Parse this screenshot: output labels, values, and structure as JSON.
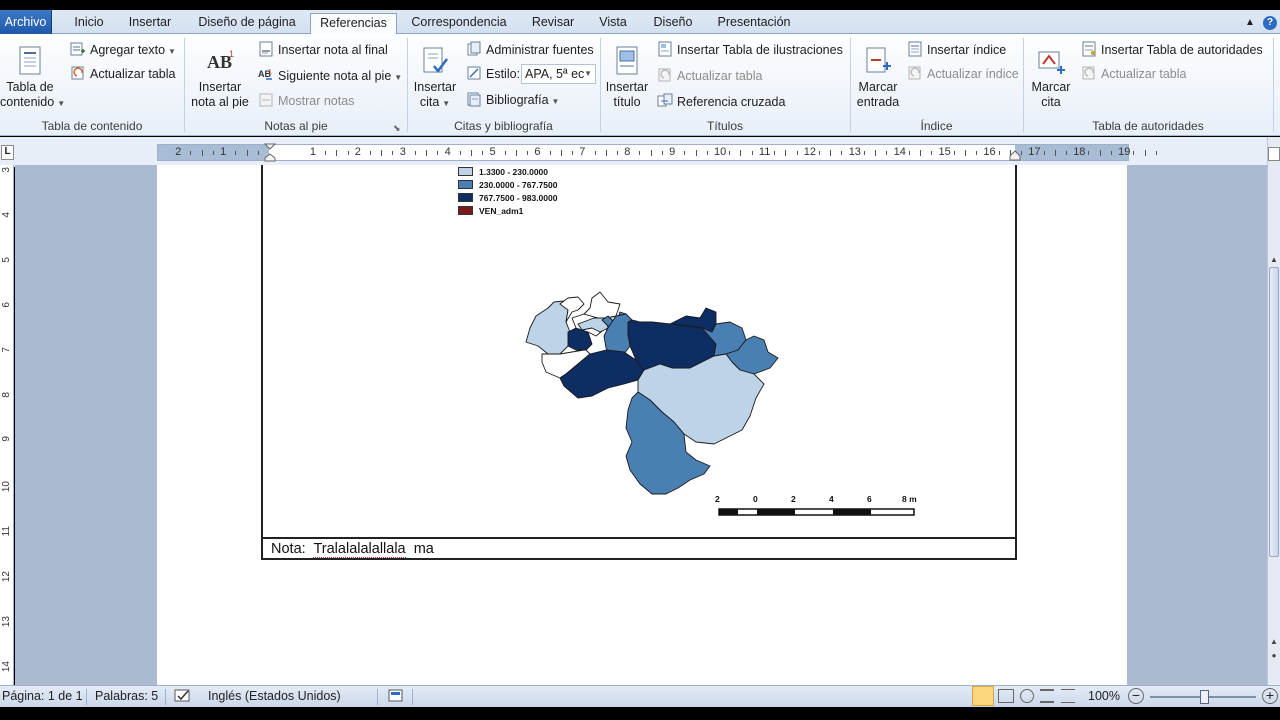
{
  "tabs": [
    {
      "label": "Archivo"
    },
    {
      "label": "Inicio"
    },
    {
      "label": "Insertar"
    },
    {
      "label": "Diseño de página"
    },
    {
      "label": "Referencias"
    },
    {
      "label": "Correspondencia"
    },
    {
      "label": "Revisar"
    },
    {
      "label": "Vista"
    },
    {
      "label": "Diseño"
    },
    {
      "label": "Presentación"
    }
  ],
  "ribbon": {
    "toc": {
      "big_label": "Tabla de\ncontenido",
      "add_text": "Agregar texto",
      "update_table": "Actualizar tabla",
      "group": "Tabla de contenido"
    },
    "footnotes": {
      "big_label": "Insertar\nnota al pie",
      "insert_endnote": "Insertar nota al final",
      "next_footnote": "Siguiente nota al pie",
      "show_notes": "Mostrar notas",
      "group": "Notas al pie"
    },
    "citations": {
      "big_label": "Insertar\ncita",
      "manage_sources": "Administrar fuentes",
      "style_label": "Estilo:",
      "style_value": "APA, 5ª ec",
      "bibliography": "Bibliografía",
      "group": "Citas y bibliografía"
    },
    "captions": {
      "big_label": "Insertar\ntítulo",
      "insert_table_figures": "Insertar Tabla de ilustraciones",
      "update_table": "Actualizar tabla",
      "cross_reference": "Referencia cruzada",
      "group": "Títulos"
    },
    "index": {
      "big_label": "Marcar\nentrada",
      "insert_index": "Insertar índice",
      "update_index": "Actualizar índice",
      "group": "Índice"
    },
    "authorities": {
      "big_label": "Marcar\ncita",
      "insert_table": "Insertar Tabla de autoridades",
      "update_table": "Actualizar tabla",
      "group": "Tabla de autoridades"
    }
  },
  "ruler": {
    "h_numbers": [
      "2",
      "1",
      "1",
      "2",
      "3",
      "4",
      "5",
      "6",
      "7",
      "8",
      "9",
      "10",
      "11",
      "12",
      "13",
      "14",
      "15",
      "16",
      "17",
      "18",
      "19"
    ],
    "v_numbers": [
      "3",
      "4",
      "5",
      "6",
      "7",
      "8",
      "9",
      "10",
      "11",
      "12",
      "13",
      "14"
    ]
  },
  "document": {
    "legend": [
      {
        "label": "1.3300 - 230.0000",
        "color": "#bcd3e8"
      },
      {
        "label": "230.0000 - 767.7500",
        "color": "#4a7fb3"
      },
      {
        "label": "767.7500 - 983.0000",
        "color": "#0e2d63"
      },
      {
        "label": "VEN_adm1",
        "color": "#7a1a1a"
      }
    ],
    "scale_labels": [
      "2",
      "0",
      "2",
      "4",
      "6",
      "8 m"
    ],
    "note_prefix": "Nota:",
    "note_text": "Tralalalalallala",
    "note_suffix": "ma"
  },
  "status": {
    "page": "Página: 1 de 1",
    "words": "Palabras: 5",
    "language": "Inglés (Estados Unidos)",
    "zoom": "100%"
  }
}
